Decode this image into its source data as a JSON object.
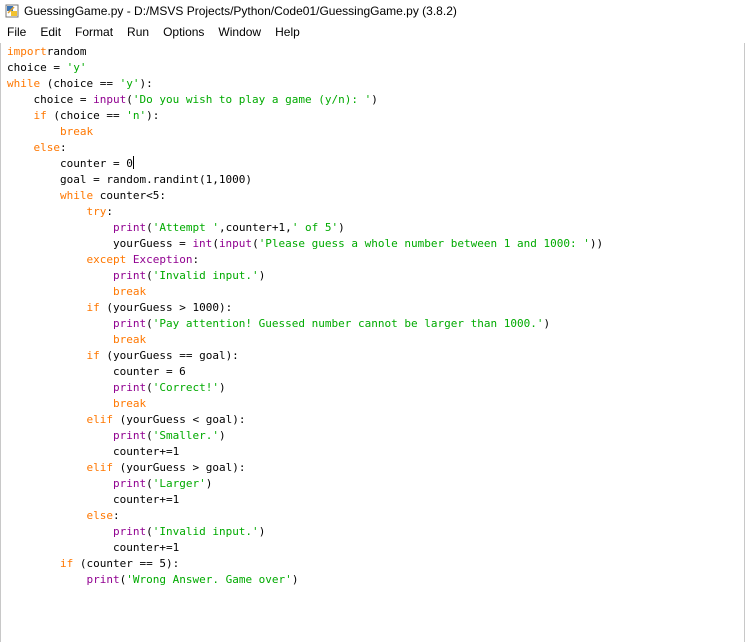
{
  "window": {
    "title": "GuessingGame.py - D:/MSVS Projects/Python/Code01/GuessingGame.py (3.8.2)",
    "icon": "python-idle-icon"
  },
  "menu": [
    "File",
    "Edit",
    "Format",
    "Run",
    "Options",
    "Window",
    "Help"
  ],
  "code": [
    [
      [
        "kw",
        "import"
      ],
      [
        "",
        "random"
      ]
    ],
    [
      [
        "",
        "choice = "
      ],
      [
        "st",
        "'y'"
      ]
    ],
    [
      [
        "kw",
        "while"
      ],
      [
        "",
        " (choice == "
      ],
      [
        "st",
        "'y'"
      ],
      [
        "",
        "):"
      ]
    ],
    [
      [
        "",
        "    choice = "
      ],
      [
        "bi",
        "input"
      ],
      [
        "",
        "("
      ],
      [
        "st",
        "'Do you wish to play a game (y/n): '"
      ],
      [
        "",
        ")"
      ]
    ],
    [
      [
        "",
        "    "
      ],
      [
        "kw",
        "if"
      ],
      [
        "",
        " (choice == "
      ],
      [
        "st",
        "'n'"
      ],
      [
        "",
        "):"
      ]
    ],
    [
      [
        "",
        "        "
      ],
      [
        "kw",
        "break"
      ]
    ],
    [
      [
        "",
        "    "
      ],
      [
        "kw",
        "else"
      ],
      [
        "",
        ":"
      ]
    ],
    [
      [
        "",
        "        counter = 0"
      ],
      [
        "cursor",
        ""
      ]
    ],
    [
      [
        "",
        "        goal = random.randint(1,1000)"
      ]
    ],
    [
      [
        "",
        "        "
      ],
      [
        "kw",
        "while"
      ],
      [
        "",
        " counter<5:"
      ]
    ],
    [
      [
        "",
        "            "
      ],
      [
        "kw",
        "try"
      ],
      [
        "",
        ":"
      ]
    ],
    [
      [
        "",
        "                "
      ],
      [
        "bi",
        "print"
      ],
      [
        "",
        "("
      ],
      [
        "st",
        "'Attempt '"
      ],
      [
        "",
        ",counter+1,"
      ],
      [
        "st",
        "' of 5'"
      ],
      [
        "",
        ")"
      ]
    ],
    [
      [
        "",
        "                yourGuess = "
      ],
      [
        "bi",
        "int"
      ],
      [
        "",
        "("
      ],
      [
        "bi",
        "input"
      ],
      [
        "",
        "("
      ],
      [
        "st",
        "'Please guess a whole number between 1 and 1000: '"
      ],
      [
        "",
        "))"
      ]
    ],
    [
      [
        "",
        "            "
      ],
      [
        "kw",
        "except"
      ],
      [
        "",
        " "
      ],
      [
        "bi",
        "Exception"
      ],
      [
        "",
        ":"
      ]
    ],
    [
      [
        "",
        "                "
      ],
      [
        "bi",
        "print"
      ],
      [
        "",
        "("
      ],
      [
        "st",
        "'Invalid input.'"
      ],
      [
        "",
        ")"
      ]
    ],
    [
      [
        "",
        "                "
      ],
      [
        "kw",
        "break"
      ]
    ],
    [
      [
        "",
        "            "
      ],
      [
        "kw",
        "if"
      ],
      [
        "",
        " (yourGuess > 1000):"
      ]
    ],
    [
      [
        "",
        "                "
      ],
      [
        "bi",
        "print"
      ],
      [
        "",
        "("
      ],
      [
        "st",
        "'Pay attention! Guessed number cannot be larger than 1000.'"
      ],
      [
        "",
        ")"
      ]
    ],
    [
      [
        "",
        "                "
      ],
      [
        "kw",
        "break"
      ]
    ],
    [
      [
        "",
        "            "
      ],
      [
        "kw",
        "if"
      ],
      [
        "",
        " (yourGuess == goal):"
      ]
    ],
    [
      [
        "",
        "                counter = 6"
      ]
    ],
    [
      [
        "",
        "                "
      ],
      [
        "bi",
        "print"
      ],
      [
        "",
        "("
      ],
      [
        "st",
        "'Correct!'"
      ],
      [
        "",
        ")"
      ]
    ],
    [
      [
        "",
        "                "
      ],
      [
        "kw",
        "break"
      ]
    ],
    [
      [
        "",
        "            "
      ],
      [
        "kw",
        "elif"
      ],
      [
        "",
        " (yourGuess < goal):"
      ]
    ],
    [
      [
        "",
        "                "
      ],
      [
        "bi",
        "print"
      ],
      [
        "",
        "("
      ],
      [
        "st",
        "'Smaller.'"
      ],
      [
        "",
        ")"
      ]
    ],
    [
      [
        "",
        "                counter+=1"
      ]
    ],
    [
      [
        "",
        "            "
      ],
      [
        "kw",
        "elif"
      ],
      [
        "",
        " (yourGuess > goal):"
      ]
    ],
    [
      [
        "",
        "                "
      ],
      [
        "bi",
        "print"
      ],
      [
        "",
        "("
      ],
      [
        "st",
        "'Larger'"
      ],
      [
        "",
        ")"
      ]
    ],
    [
      [
        "",
        "                counter+=1"
      ]
    ],
    [
      [
        "",
        "            "
      ],
      [
        "kw",
        "else"
      ],
      [
        "",
        ":"
      ]
    ],
    [
      [
        "",
        "                "
      ],
      [
        "bi",
        "print"
      ],
      [
        "",
        "("
      ],
      [
        "st",
        "'Invalid input.'"
      ],
      [
        "",
        ")"
      ]
    ],
    [
      [
        "",
        "                counter+=1"
      ]
    ],
    [
      [
        "",
        "        "
      ],
      [
        "kw",
        "if"
      ],
      [
        "",
        " (counter == 5):"
      ]
    ],
    [
      [
        "",
        "            "
      ],
      [
        "bi",
        "print"
      ],
      [
        "",
        "("
      ],
      [
        "st",
        "'Wrong Answer. Game over'"
      ],
      [
        "",
        ")"
      ]
    ]
  ],
  "colors": {
    "keyword": "#ff7700",
    "builtin": "#900090",
    "string": "#00aa00",
    "text": "#000000"
  }
}
